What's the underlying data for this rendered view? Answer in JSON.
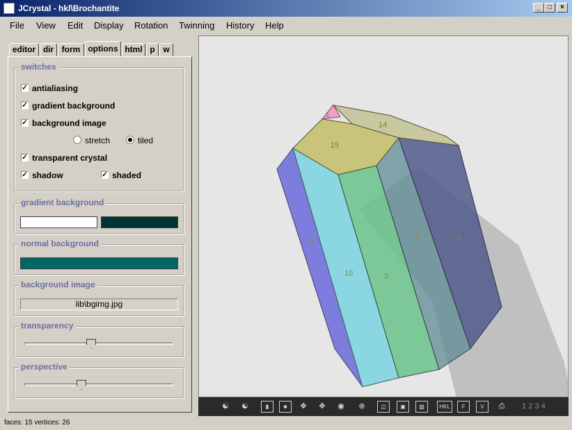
{
  "window": {
    "title": "JCrystal - hkl\\Brochantite"
  },
  "menu": [
    "File",
    "View",
    "Edit",
    "Display",
    "Rotation",
    "Twinning",
    "History",
    "Help"
  ],
  "tabs": [
    "editor",
    "dir",
    "form",
    "options",
    "html",
    "p",
    "w"
  ],
  "switches": {
    "title": "switches",
    "antialiasing": "antialiasing",
    "gradient_background": "gradient background",
    "background_image": "background image",
    "stretch": "stretch",
    "tiled": "tiled",
    "transparent_crystal": "transparent crystal",
    "shadow": "shadow",
    "shaded": "shaded"
  },
  "gradient_background": {
    "title": "gradient background",
    "color1": "#ffffff",
    "color2": "#003333"
  },
  "normal_background": {
    "title": "normal background",
    "color": "#006666"
  },
  "background_image": {
    "title": "background image",
    "file": "lib\\bgimg.jpg"
  },
  "transparency": {
    "title": "transparency",
    "value": 0.45
  },
  "perspective": {
    "title": "perspective",
    "value": 0.38
  },
  "faces": {
    "f1": "1",
    "f14": "14",
    "f15": "15",
    "f6": "6",
    "f10": "10",
    "f3": "3",
    "f9": "9",
    "f5": "5"
  },
  "toolbar": {
    "layers": "1 2 3 4",
    "hkl": "HKL",
    "f": "F",
    "v": "V"
  },
  "status": "faces: 15  vertices: 26"
}
